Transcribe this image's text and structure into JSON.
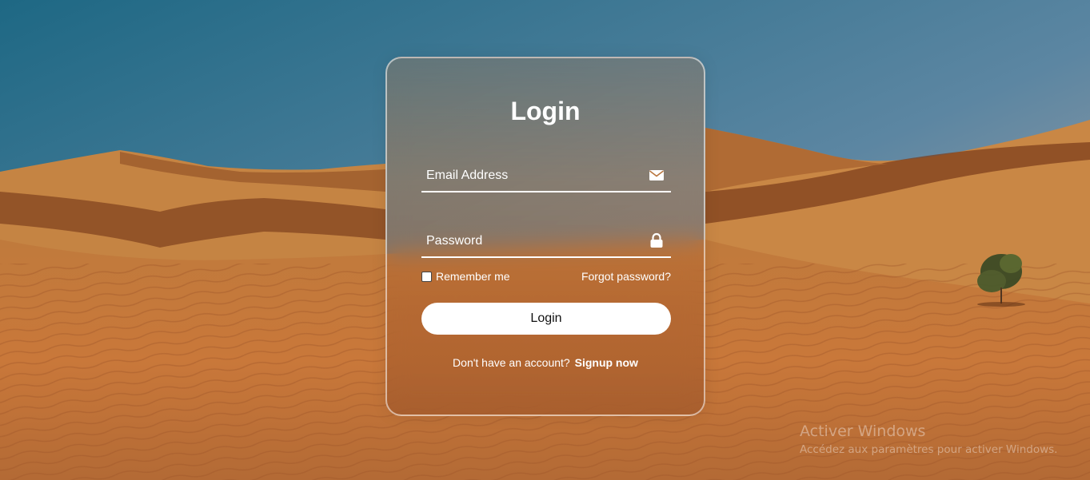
{
  "background": {
    "scene": "desert-dunes-photo",
    "colors": {
      "sky_top": "#1f6a86",
      "sky_bottom": "#b9a8a6",
      "sand_light": "#d08a45",
      "sand_dark": "#8a4a22"
    }
  },
  "login": {
    "title": "Login",
    "email": {
      "placeholder": "Email Address",
      "icon": "envelope-icon"
    },
    "password": {
      "placeholder": "Password",
      "icon": "lock-icon"
    },
    "remember_label": "Remember me",
    "remember_checked": false,
    "forgot_label": "Forgot password?",
    "submit_label": "Login",
    "signup_prompt": "Don't have an account?",
    "signup_link": "Signup now"
  },
  "watermark": {
    "line1": "Activer Windows",
    "line2": "Accédez aux paramètres pour activer Windows."
  }
}
